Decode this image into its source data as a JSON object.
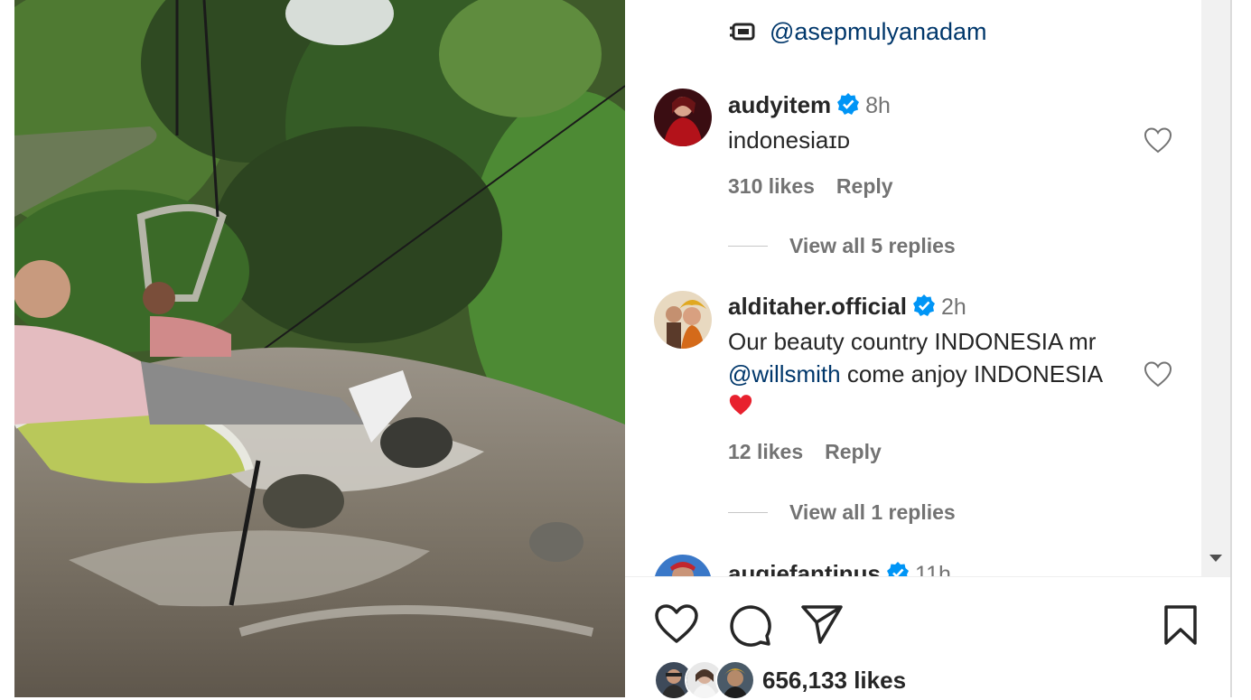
{
  "post": {
    "mention": "@asepmulyanadam",
    "likes": "656,133 likes"
  },
  "comments": [
    {
      "username": "audyitem",
      "time": "8h",
      "text": "indonesiaɪᴅ",
      "likes": "310 likes",
      "reply": "Reply",
      "view_replies": "View all 5 replies"
    },
    {
      "username": "alditaher.official",
      "time": "2h",
      "text_line1": "Our beauty country INDONESIA mr",
      "mention": "@willsmith",
      "text_line2_rest": " come anjoy INDONESIA",
      "emoji": "❤️",
      "likes": "12 likes",
      "reply": "Reply",
      "view_replies": "View all 1 replies"
    },
    {
      "username": "augiefantinus",
      "time": "11h"
    }
  ],
  "colors": {
    "verified": "#0095f6",
    "link": "#00376b",
    "muted": "#737373",
    "heart_red": "#ed4956"
  },
  "icons": [
    "tv-icon",
    "verified-icon",
    "heart-icon",
    "comment-icon",
    "share-icon",
    "bookmark-icon"
  ]
}
